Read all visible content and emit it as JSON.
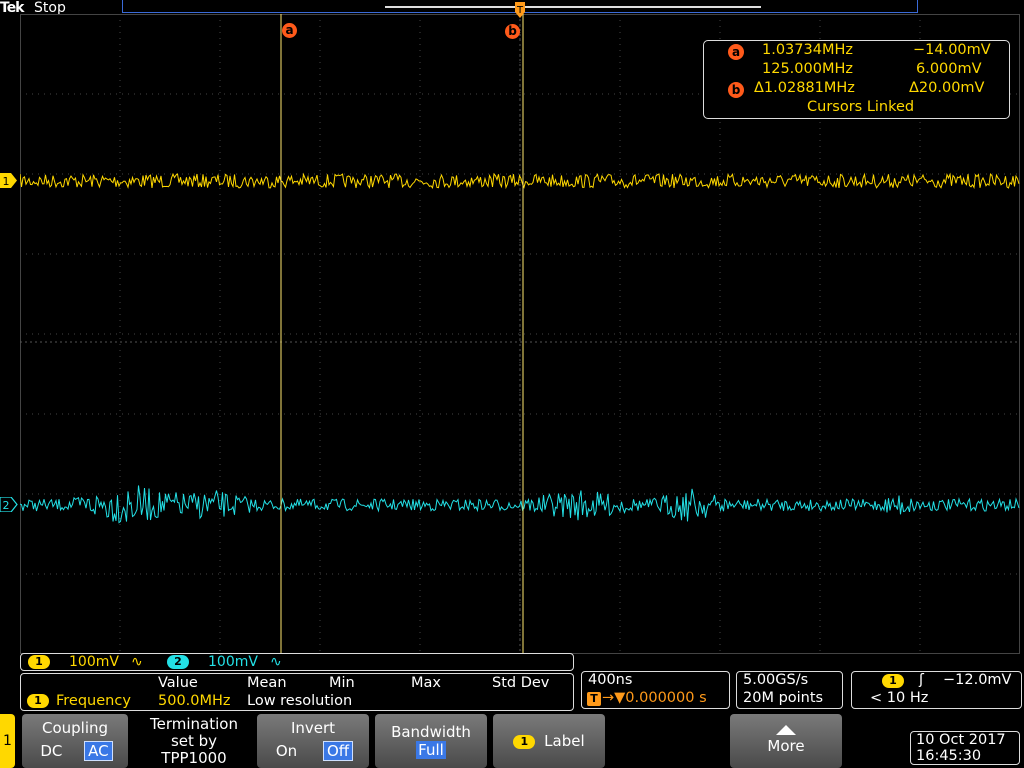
{
  "header": {
    "brand": "Tek",
    "run_state": "Stop"
  },
  "cursors": {
    "a_tag": "a",
    "b_tag": "b",
    "a_row1_freq": "1.03734MHz",
    "a_row1_volt": "−14.00mV",
    "row2_freq": "125.000MHz",
    "row2_volt": "6.000mV",
    "delta_freq": "Δ1.02881MHz",
    "delta_volt": "Δ20.00mV",
    "linked": "Cursors Linked"
  },
  "channels": {
    "ch1": {
      "label": "1",
      "scale": "100mV",
      "coupling_glyph": "∿",
      "color": "#ffd800"
    },
    "ch2": {
      "label": "2",
      "scale": "100mV",
      "coupling_glyph": "∿",
      "color": "#23e0e6"
    }
  },
  "measurement": {
    "source": "1",
    "name": "Frequency",
    "headers": [
      "Value",
      "Mean",
      "Min",
      "Max",
      "Std Dev"
    ],
    "value": "500.0MHz",
    "note": "Low resolution"
  },
  "horizontal": {
    "timebase": "400ns",
    "trigger_icon": "T",
    "position": "→▼0.000000 s"
  },
  "acquisition": {
    "sample_rate": "5.00GS/s",
    "record_length": "20M points"
  },
  "trigger": {
    "source": "1",
    "slope_glyph": "ʃ",
    "level": "−12.0mV",
    "freq": "< 10 Hz"
  },
  "menu": {
    "side_tab": "1",
    "coupling": {
      "title": "Coupling",
      "opt_dc": "DC",
      "opt_ac": "AC"
    },
    "termination": {
      "line1": "Termination",
      "line2": "set by",
      "line3": "TPP1000"
    },
    "invert": {
      "title": "Invert",
      "opt_on": "On",
      "opt_off": "Off"
    },
    "bandwidth": {
      "title": "Bandwidth",
      "value": "Full"
    },
    "label": {
      "ch": "1",
      "title": "Label"
    },
    "more": {
      "title": "More"
    }
  },
  "datetime": {
    "date": "10 Oct  2017",
    "time": "16:45:30"
  },
  "colors": {
    "ch1": "#ffd800",
    "ch2": "#23e0e6",
    "cursor": "#ff5a1a",
    "selected": "#3a78e6"
  }
}
